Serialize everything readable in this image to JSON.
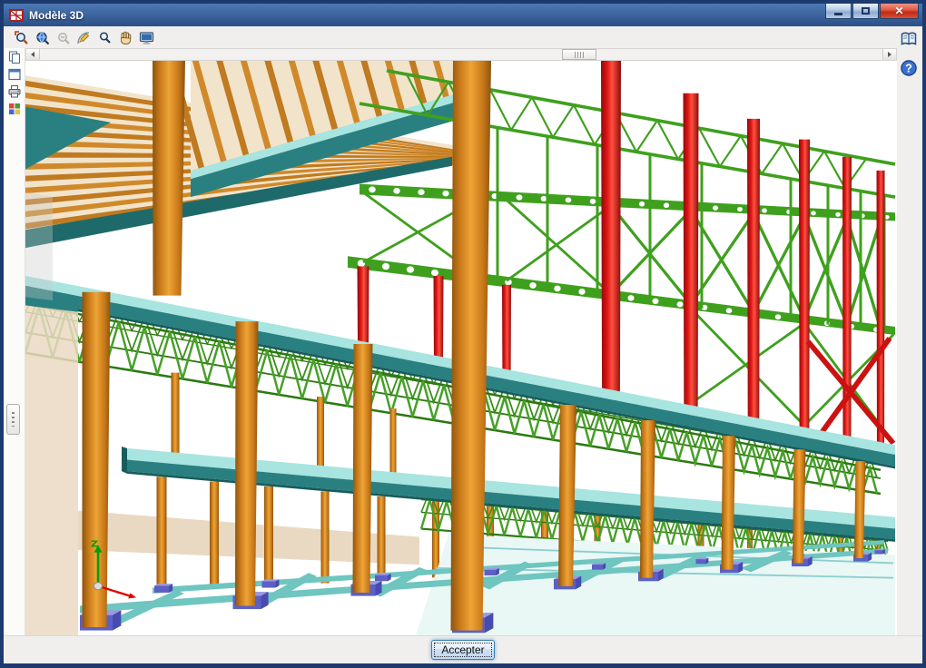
{
  "window": {
    "title": "Modèle 3D",
    "controls": {
      "close_glyph": "✕"
    }
  },
  "toolbar": {
    "buttons": [
      {
        "name": "zoom-window"
      },
      {
        "name": "zoom-extents"
      },
      {
        "name": "zoom-previous"
      },
      {
        "name": "measure-angle"
      },
      {
        "name": "zoom-realtime"
      },
      {
        "name": "pan"
      },
      {
        "name": "capture-view"
      }
    ]
  },
  "left_rail": {
    "buttons": [
      {
        "name": "copy-view"
      },
      {
        "name": "new-window"
      },
      {
        "name": "print"
      },
      {
        "name": "render-options"
      }
    ]
  },
  "right_rail": {
    "help_glyph": "?"
  },
  "footer": {
    "accept_label": "Accepter"
  },
  "viewport": {
    "axis_label_z": "Z"
  },
  "colors": {
    "win_border": "#1c3a6d",
    "titlebar_top": "#4e79b4",
    "titlebar_bottom": "#2b4f87",
    "title_text": "#ffffff",
    "close_top": "#ef9384",
    "close_bottom": "#c02a12",
    "toolbar_bg": "#f0efed",
    "footer_bg": "#f0efed",
    "accept_border": "#3c7fb1",
    "column": "#c87818",
    "column_light": "#eda437",
    "column_dark": "#8a5510",
    "steel_green": "#3fa01e",
    "steel_green_dark": "#2b7a10",
    "steel_red": "#dd1414",
    "steel_red_dark": "#8f0a0a",
    "slab_top": "#a8e4e0",
    "slab_fascia": "#2a8080",
    "slab_edge": "#175c5c",
    "roof_deck": "#f2e4cb",
    "joist": "#d0892a",
    "joist_alt": "#c07a20",
    "wall": "#ead9c2",
    "foundation_top": "#9a9ae0",
    "foundation_front": "#5c60c4",
    "foundation_side": "#474bb0",
    "tie_beam": "#6fc5c0",
    "ground_slab": "#e9f7f5",
    "axis_z": "#00a000",
    "axis_x": "#e00000"
  }
}
